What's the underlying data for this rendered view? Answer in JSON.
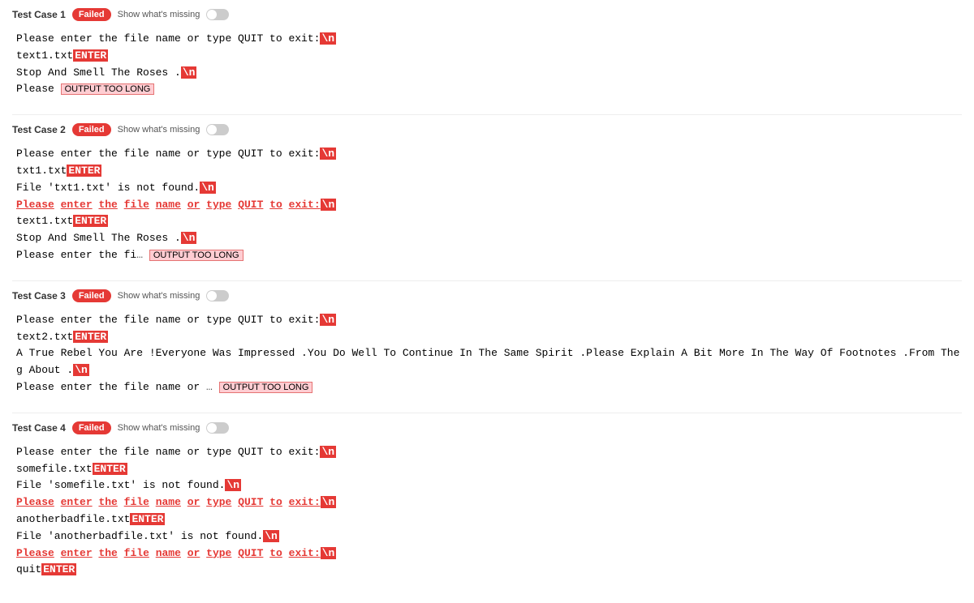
{
  "testCases": [
    {
      "id": "Test Case 1",
      "status": "Failed",
      "showMissing": "Show what's missing",
      "lines": [
        {
          "type": "prompt",
          "text": "Please enter the file name or type QUIT to exit:",
          "newline": true
        },
        {
          "type": "input",
          "text": "text1.txt",
          "enter": true
        },
        {
          "type": "output-mixed",
          "text": "Stop And Smell The Roses .",
          "newline": true
        },
        {
          "type": "output-truncated",
          "text": "Please ",
          "ellipsis": "...",
          "tag": "OUTPUT TOO LONG"
        }
      ]
    },
    {
      "id": "Test Case 2",
      "status": "Failed",
      "showMissing": "Show what's missing",
      "lines": [
        {
          "type": "prompt",
          "text": "Please enter the file name or type QUIT to exit:",
          "newline": true
        },
        {
          "type": "input",
          "text": "txt1.txt",
          "enter": true
        },
        {
          "type": "output",
          "text": "File 'txt1.txt' is not found.",
          "newline": true
        },
        {
          "type": "prompt-red",
          "text": "Please enter the file name or type QUIT to exit:",
          "newline": true
        },
        {
          "type": "input",
          "text": "text1.txt",
          "enter": true
        },
        {
          "type": "output-mixed2",
          "text": "Stop And Smell The Roses .",
          "newline": true
        },
        {
          "type": "output-truncated2",
          "text": "Please enter the fi",
          "ellipsis": "...",
          "tag": "OUTPUT TOO LONG"
        }
      ]
    },
    {
      "id": "Test Case 3",
      "status": "Failed",
      "showMissing": "Show what's missing",
      "lines": [
        {
          "type": "prompt",
          "text": "Please enter the file name or type QUIT to exit:",
          "newline": true
        },
        {
          "type": "input",
          "text": "text2.txt",
          "enter": true
        },
        {
          "type": "long-output",
          "text": "A True Rebel You Are !Everyone Was Impressed .You Do Well To Continue In The Same Spirit .Please Explain A Bit More In The Way Of Footnotes .From The Given Text It Not Clear What Are We Reading About .",
          "newline": true
        },
        {
          "type": "output-truncated3",
          "text": "Please enter the file name or ",
          "ellipsis": "...",
          "tag": "OUTPUT TOO LONG"
        }
      ]
    },
    {
      "id": "Test Case 4",
      "status": "Failed",
      "showMissing": "Show what's missing",
      "lines": [
        {
          "type": "prompt",
          "text": "Please enter the file name or type QUIT to exit:",
          "newline": true
        },
        {
          "type": "input",
          "text": "somefile.txt",
          "enter": true
        },
        {
          "type": "output",
          "text": "File 'somefile.txt' is not found.",
          "newline": true
        },
        {
          "type": "prompt-red2",
          "text": "Please enter the file name or type QUIT to exit:",
          "newline": true
        },
        {
          "type": "input",
          "text": "anotherbadfile.txt",
          "enter": true
        },
        {
          "type": "output2",
          "text": "File 'anotherbadfile.txt' is not found.",
          "newline": true
        },
        {
          "type": "prompt-red3",
          "text": "Please enter the file name or type QUIT to exit:",
          "newline": true
        },
        {
          "type": "input-quit",
          "text": "quit",
          "enter": true
        }
      ]
    }
  ]
}
